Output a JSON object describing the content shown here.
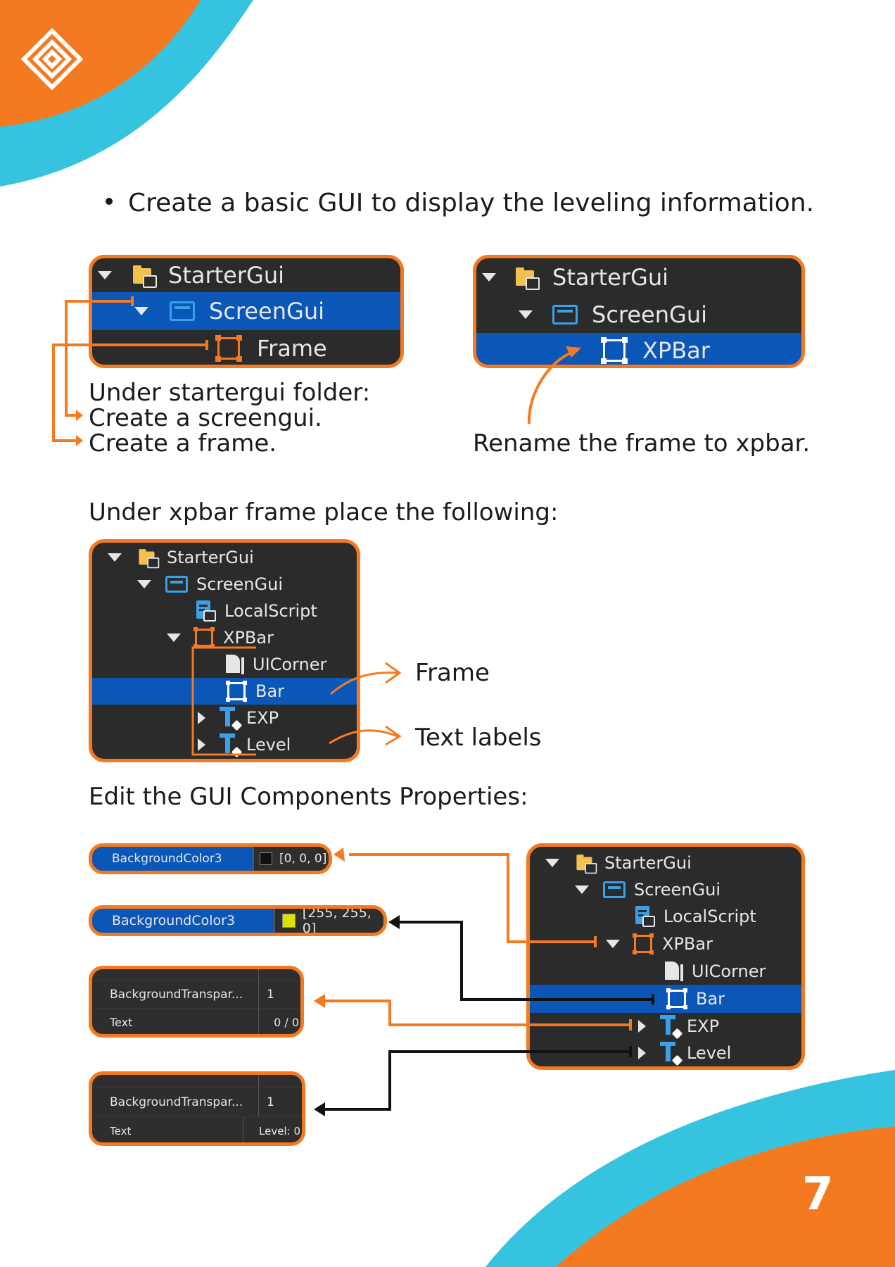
{
  "colors": {
    "orange": "#f47a22",
    "cyan": "#36c3e0",
    "selection": "#0b57b8",
    "panel": "#2b2b2b"
  },
  "icons": [
    "diamond-logo-icon",
    "folder-icon",
    "screengui-icon",
    "frame-icon",
    "localscript-icon",
    "uicorner-icon",
    "textlabel-icon",
    "expand-arrow-icon",
    "collapse-arrow-icon"
  ],
  "bullet": "Create a basic GUI to display the leveling information.",
  "panel1": {
    "items": [
      "StarterGui",
      "ScreenGui",
      "Frame"
    ]
  },
  "panel1_caption": {
    "line1": "Under startergui folder:",
    "line2": "Create a screengui.",
    "line3": "Create a frame."
  },
  "panel2": {
    "items": [
      "StarterGui",
      "ScreenGui",
      "XPBar"
    ]
  },
  "panel2_caption": "Rename the frame to xpbar.",
  "section2_heading": "Under xpbar frame place the following:",
  "tree": {
    "items": [
      "StarterGui",
      "ScreenGui",
      "LocalScript",
      "XPBar",
      "UICorner",
      "Bar",
      "EXP",
      "Level"
    ]
  },
  "labels": {
    "frame": "Frame",
    "text_labels": "Text labels"
  },
  "section3_heading": "Edit the GUI Components Properties:",
  "props": {
    "xpbar_bg": {
      "name": "BackgroundColor3",
      "value": "[0, 0, 0]",
      "swatch": "#111111"
    },
    "bar_bg": {
      "name": "BackgroundColor3",
      "value": "[255, 255, 0]",
      "swatch": "#e0e000"
    },
    "exp": {
      "k1": "BackgroundTranspar...",
      "v1": "1",
      "k2": "Text",
      "v2": "0 / 0"
    },
    "level": {
      "k1": "BackgroundTranspar...",
      "v1": "1",
      "k2": "Text",
      "v2": "Level: 0"
    }
  },
  "tree2": {
    "items": [
      "StarterGui",
      "ScreenGui",
      "LocalScript",
      "XPBar",
      "UICorner",
      "Bar",
      "EXP",
      "Level"
    ]
  },
  "page_number": "7"
}
